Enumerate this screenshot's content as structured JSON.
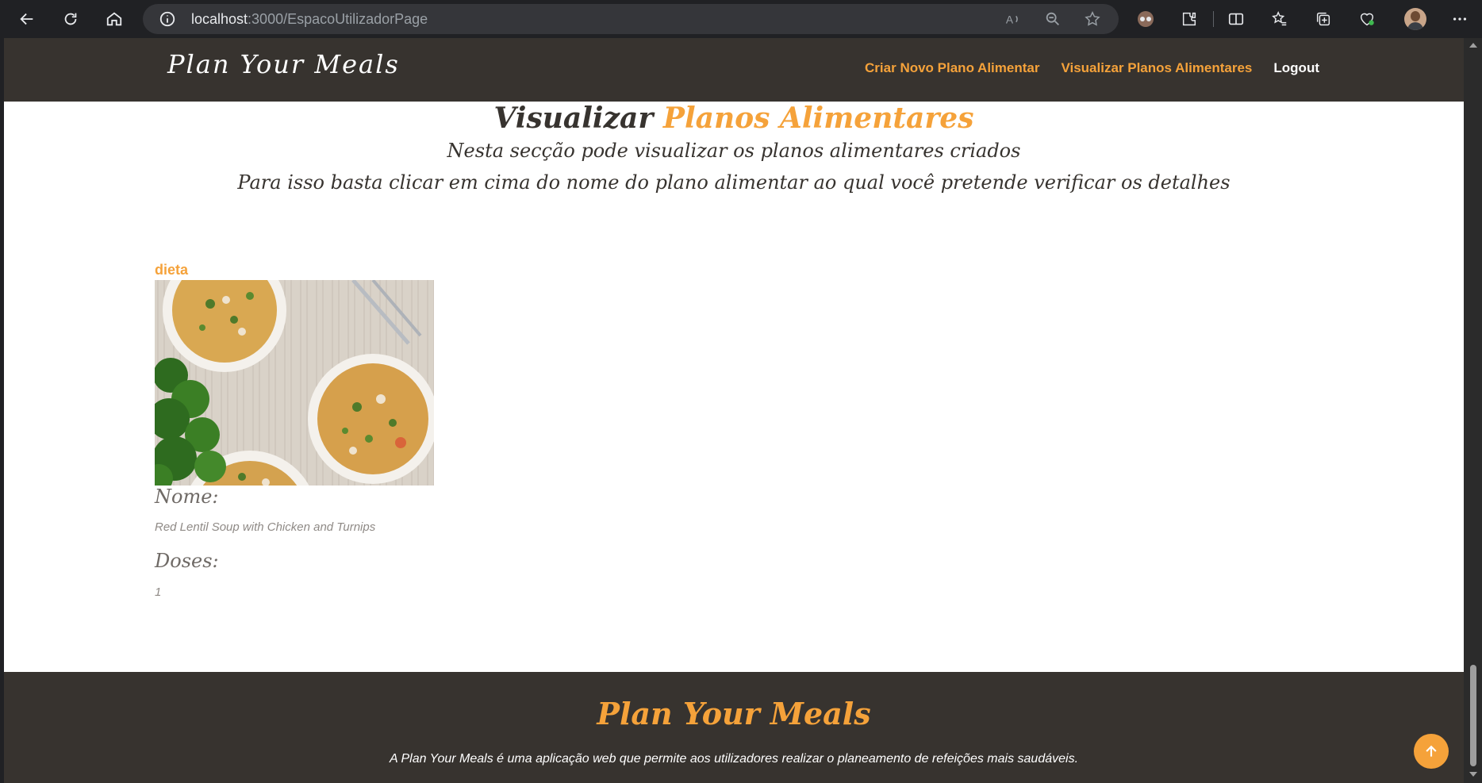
{
  "browser": {
    "url_host": "localhost",
    "url_path": ":3000/EspacoUtilizadorPage"
  },
  "nav": {
    "brand": "Plan Your Meals",
    "links": [
      {
        "label": "Criar Novo Plano Alimentar"
      },
      {
        "label": "Visualizar Planos Alimentares"
      },
      {
        "label": "Logout"
      }
    ]
  },
  "hero": {
    "title_part1": "Visualizar ",
    "title_part2": "Planos Alimentares",
    "subtitle1": "Nesta secção pode visualizar os planos alimentares criados",
    "subtitle2": "Para isso basta clicar em cima do nome do plano alimentar ao qual você pretende verificar os detalhes"
  },
  "plan": {
    "name": "dieta",
    "nome_label": "Nome:",
    "nome_value": "Red Lentil Soup with Chicken and Turnips",
    "doses_label": "Doses:",
    "doses_value": "1"
  },
  "footer": {
    "title": "Plan Your Meals",
    "text": "A Plan Your Meals é uma aplicação web que permite aos utilizadores realizar o planeamento de refeições mais saudáveis."
  },
  "colors": {
    "accent": "#f5a23a",
    "dark": "#37332f"
  }
}
